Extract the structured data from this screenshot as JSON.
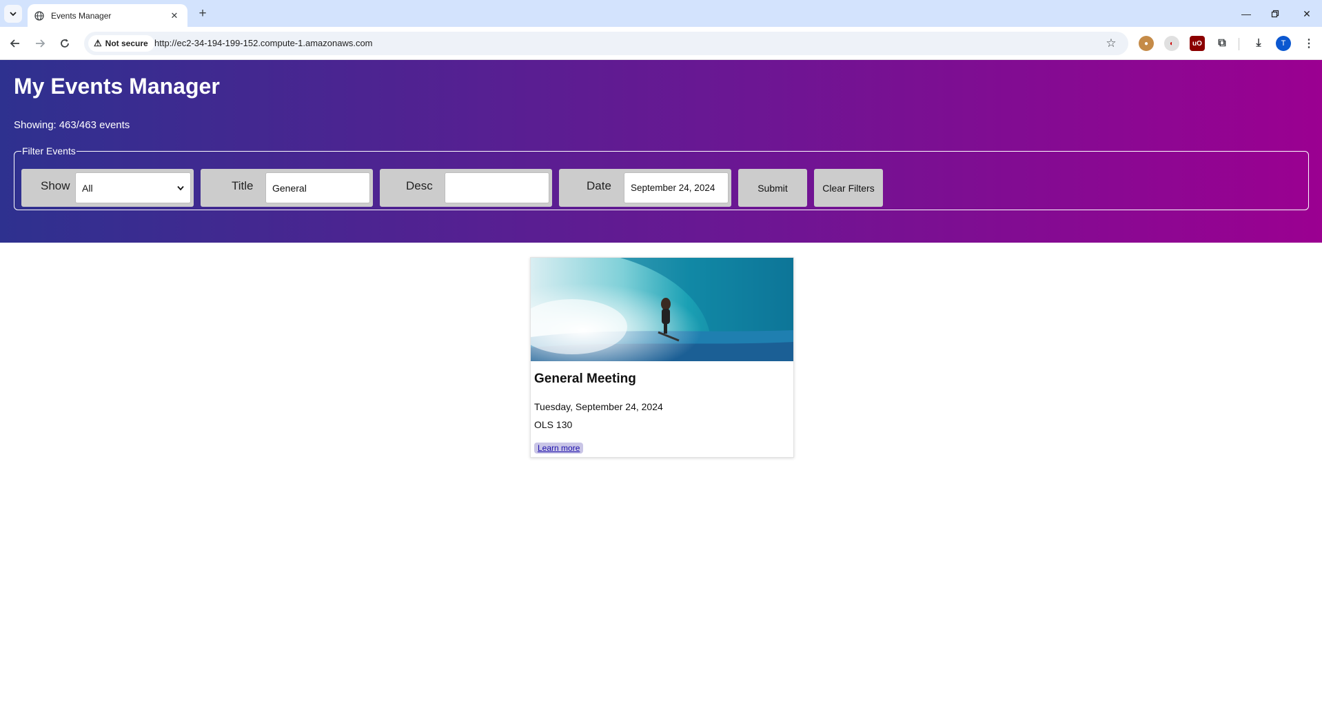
{
  "browser": {
    "tab_title": "Events Manager",
    "security_label": "Not secure",
    "url": "http://ec2-34-194-199-152.compute-1.amazonaws.com",
    "profile_initial": "T"
  },
  "page": {
    "title": "My Events Manager",
    "showing_label": "Showing:",
    "showing_count": "463/463 events"
  },
  "filters": {
    "legend": "Filter Events",
    "show_label": "Show",
    "show_value": "All",
    "title_label": "Title",
    "title_value": "General",
    "desc_label": "Desc",
    "desc_value": "",
    "date_label": "Date",
    "date_value": "September 24, 2024",
    "submit_label": "Submit",
    "clear_label": "Clear Filters"
  },
  "events": [
    {
      "title": "General Meeting",
      "date": "Tuesday, September 24, 2024",
      "location": "OLS 130",
      "link_label": "Learn more"
    }
  ],
  "colors": {
    "hero_start": "#2e318f",
    "hero_mid": "#6a1793",
    "hero_end": "#9b0091",
    "filter_bg": "#cccccc"
  }
}
